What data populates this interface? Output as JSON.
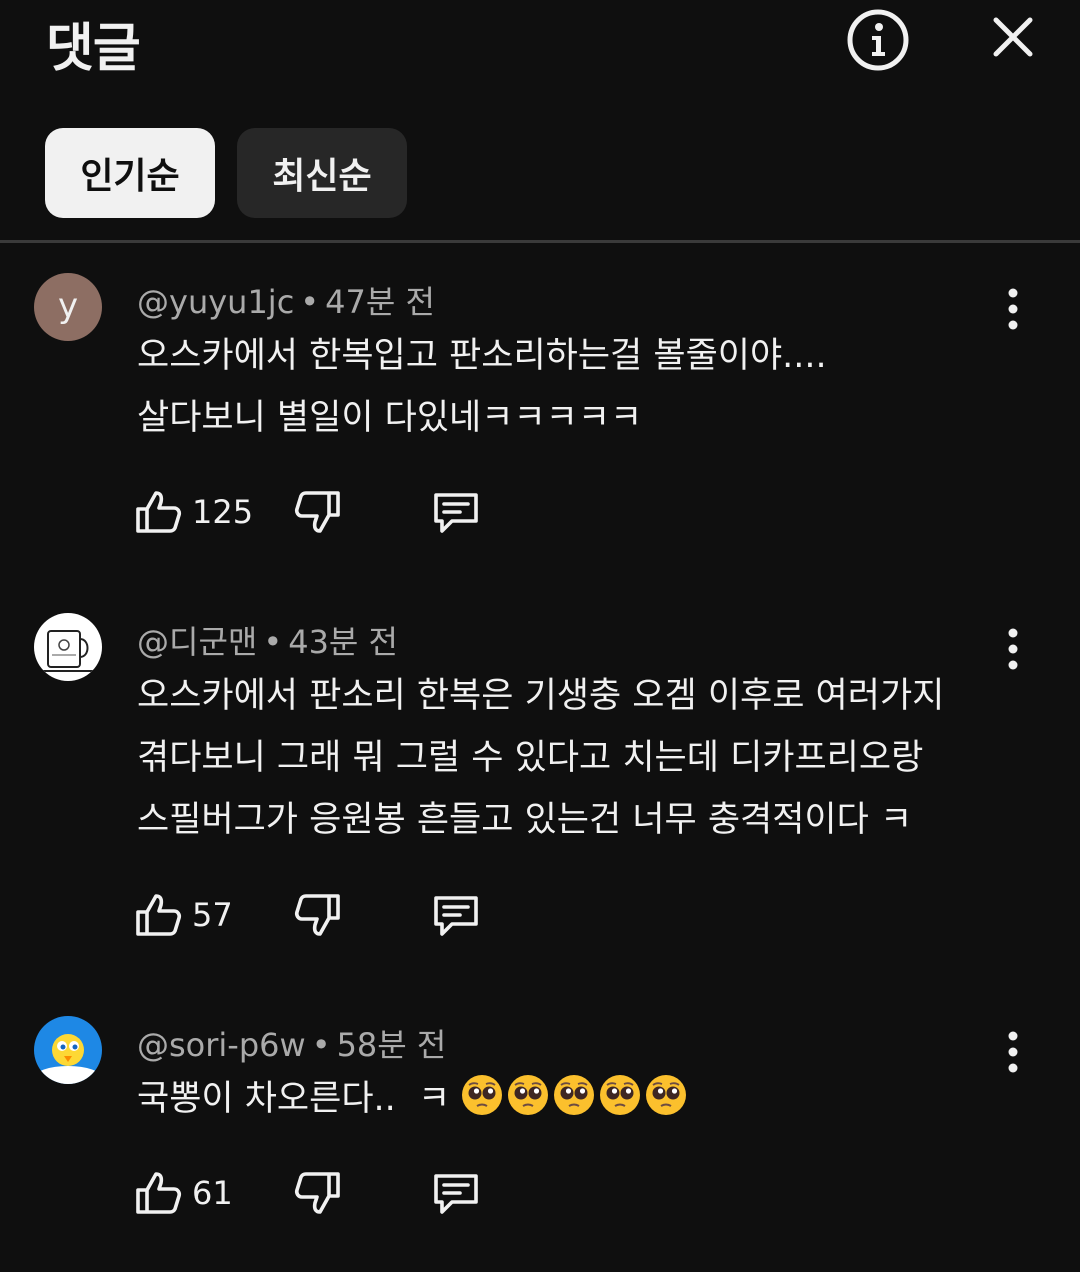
{
  "header": {
    "title": "댓글",
    "info_icon": "info-circle-icon",
    "close_icon": "close-icon"
  },
  "sort": {
    "active_label": "인기순",
    "inactive_label": "최신순"
  },
  "comments": [
    {
      "author": "@yuyu1jc",
      "time": "47분 전",
      "avatar_letter": "y",
      "avatar_color": "#8d6e63",
      "lines": [
        "오스카에서 한복입고 판소리하는걸 볼줄이야....",
        "살다보니 별일이 다있네ㅋㅋㅋㅋㅋ"
      ],
      "likes": "125"
    },
    {
      "author": "@디군맨",
      "time": "43분 전",
      "lines": [
        "오스카에서 판소리 한복은 기생충 오겜 이후로 여러가지",
        "겪다보니 그래 뭐 그럴 수 있다고 치는데 디카프리오랑",
        "스필버그가 응원봉 흔들고 있는건 너무 충격적이다 ㅋ"
      ],
      "likes": "57"
    },
    {
      "author": "@sori-p6w",
      "time": "58분 전",
      "lines": [
        "국뽕이 차오른다..  ㅋ "
      ],
      "emoji": "pleading-face-emoji",
      "emoji_count": 5,
      "likes": "61"
    }
  ],
  "icons": {
    "like": "thumbs-up-icon",
    "dislike": "thumbs-down-icon",
    "reply": "reply-comment-icon",
    "more": "more-vertical-icon"
  }
}
